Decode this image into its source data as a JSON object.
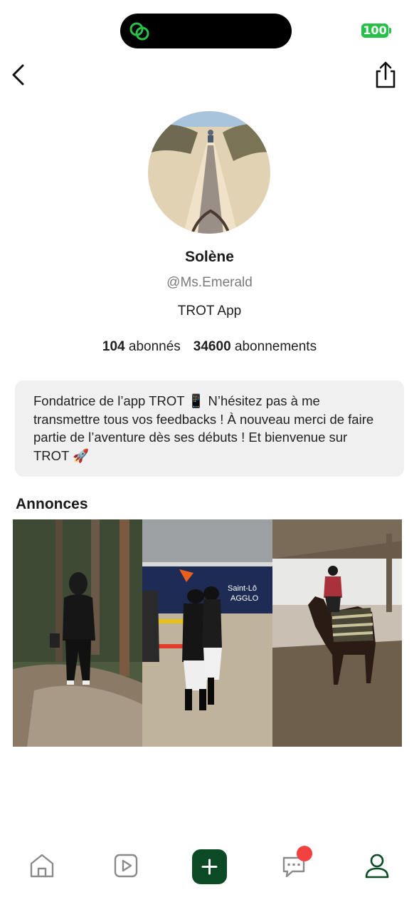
{
  "status_bar": {
    "battery": "100"
  },
  "profile": {
    "name": "Solène",
    "handle": "@Ms.Emerald",
    "organization": "TROT App",
    "followers_count": "104",
    "followers_label": "abonnés",
    "following_count": "34600",
    "following_label": "abonnements",
    "bio": "Fondatrice de l’app TROT 📱 N’hésitez pas à me transmettre tous vos feedbacks ! À nouveau merci de faire partie de l’aventure dès ses débuts ! Et bienvenue sur TROT 🚀"
  },
  "announcements": {
    "title": "Annonces",
    "items": [
      {
        "icon": "photo-woman-forest"
      },
      {
        "icon": "photo-riders-arena"
      },
      {
        "icon": "photo-horse-manege"
      }
    ]
  },
  "tab_bar": {
    "items": [
      "home-icon",
      "video-icon",
      "add-icon",
      "messages-icon",
      "profile-icon"
    ],
    "messages_has_badge": true
  },
  "colors": {
    "accent": "#0c4a26",
    "battery": "#27c14a",
    "badge": "#f24141",
    "bio_bg": "#f0f0f0"
  }
}
